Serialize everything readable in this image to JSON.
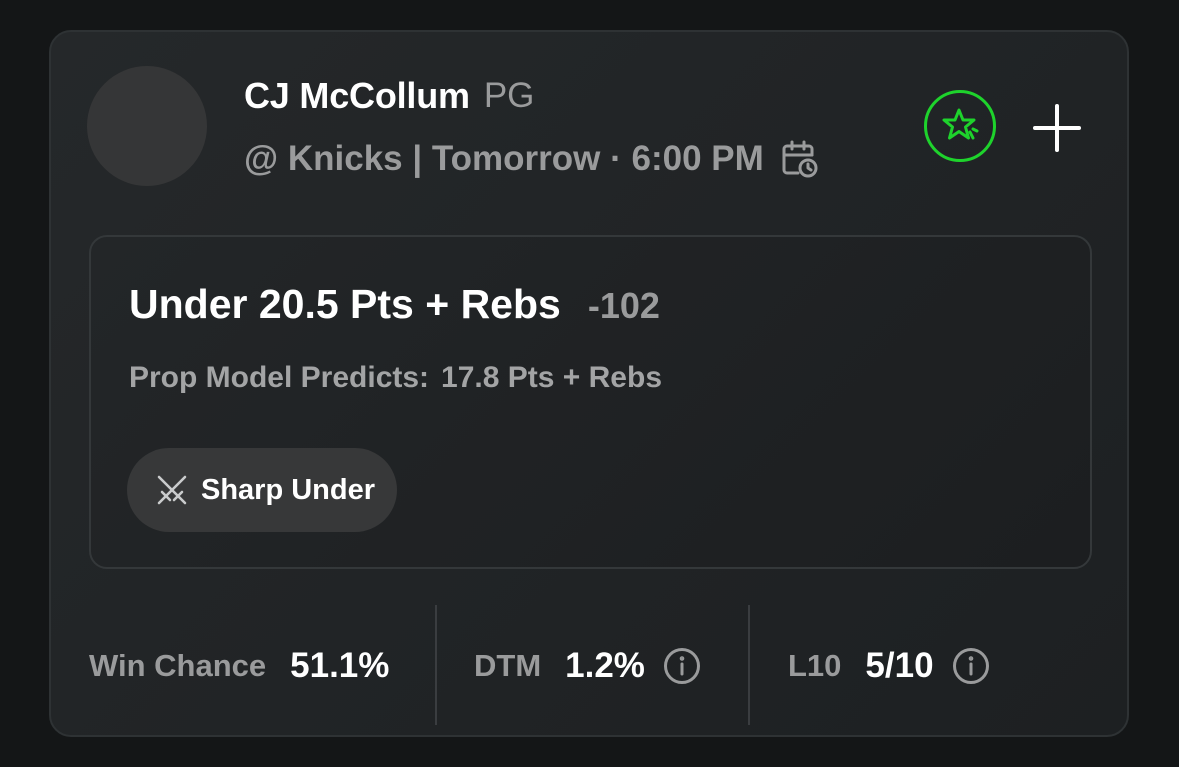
{
  "player": {
    "name": "CJ McCollum",
    "position": "PG",
    "game_info": "@ Knicks | Tomorrow · 6:00 PM"
  },
  "icons": {
    "calendar": "calendar-clock-icon",
    "favorite": "sparkle-star-icon",
    "add": "plus-icon",
    "tag": "crossed-swords-icon",
    "info": "info-icon"
  },
  "colors": {
    "accent_green": "#1ed32c",
    "background": "#141617",
    "card": "#232628",
    "muted_text": "#9a9b9c"
  },
  "prop": {
    "title": "Under 20.5 Pts + Rebs",
    "odds": "-102",
    "prediction_label": "Prop Model Predicts:",
    "prediction_value": "17.8 Pts + Rebs",
    "tag_icon": "⚔️",
    "tag_label": "Sharp Under"
  },
  "stats": [
    {
      "label": "Win Chance",
      "value": "51.1%"
    },
    {
      "label": "DTM",
      "value": "1.2%"
    },
    {
      "label": "L10",
      "value": "5/10"
    }
  ]
}
